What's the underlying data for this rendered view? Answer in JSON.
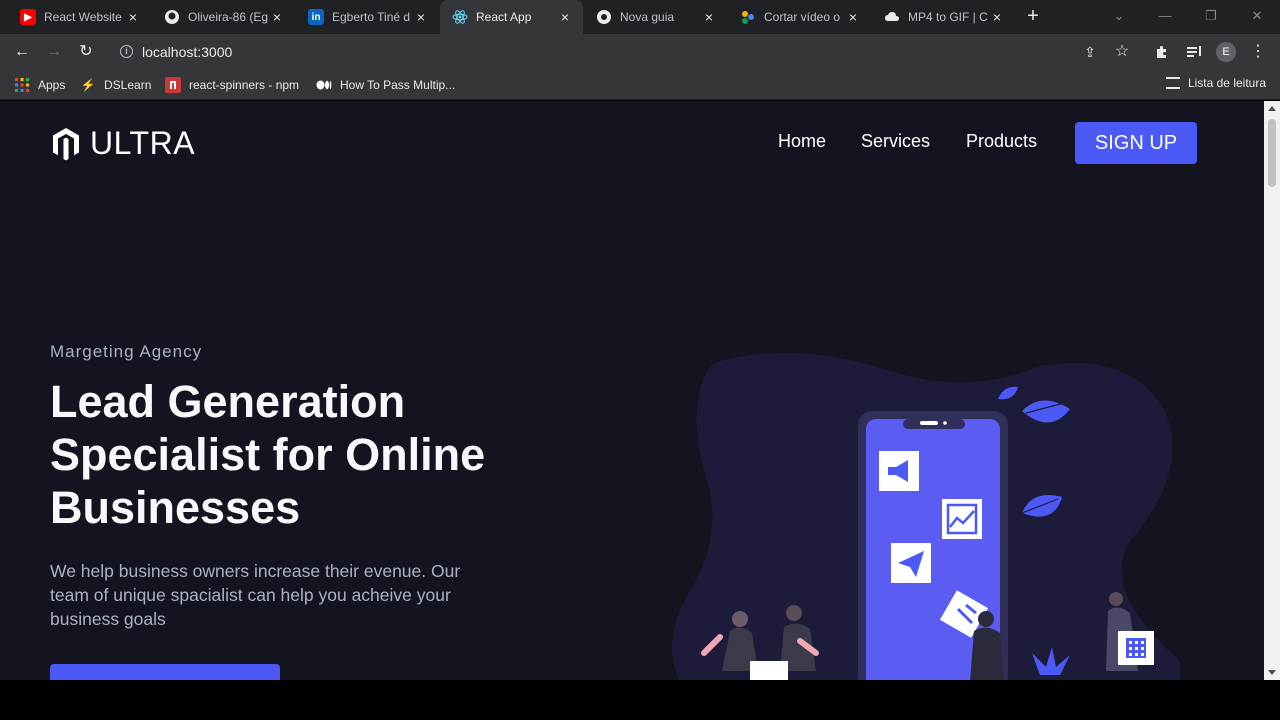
{
  "browser": {
    "tabs": [
      {
        "title": "React Website",
        "favicon": "youtube-icon",
        "active": false
      },
      {
        "title": "Oliveira-86 (Eg",
        "favicon": "github-icon",
        "active": false
      },
      {
        "title": "Egberto Tiné d",
        "favicon": "linkedin-icon",
        "active": false
      },
      {
        "title": "React App",
        "favicon": "react-icon",
        "active": true
      },
      {
        "title": "Nova guia",
        "favicon": "chrome-icon",
        "active": false
      },
      {
        "title": "Cortar vídeo o",
        "favicon": "clipchamp-icon",
        "active": false
      },
      {
        "title": "MP4 to GIF | C",
        "favicon": "cloudconvert-icon",
        "active": false
      }
    ],
    "url": "localhost:3000",
    "profile_initial": "E",
    "bookmarks": [
      {
        "label": "Apps",
        "icon": "apps-grid-icon"
      },
      {
        "label": "DSLearn",
        "icon": "lightning-icon"
      },
      {
        "label": "react-spinners - npm",
        "icon": "npm-icon"
      },
      {
        "label": "How To Pass Multip...",
        "icon": "medium-icon"
      }
    ],
    "reading_list": "Lista de leitura"
  },
  "page": {
    "brand": "ULTRA",
    "nav": [
      "Home",
      "Services",
      "Products"
    ],
    "signup": "SIGN UP",
    "eyebrow": "Margeting Agency",
    "headline": "Lead Generation Specialist for Online Businesses",
    "description": "We help business owners increase their evenue. Our team of unique spacialist can help you acheive your business goals",
    "colors": {
      "background": "#141420",
      "accent": "#4b59f7",
      "text_primary": "#f7f8fa",
      "text_secondary": "#a9b3c1",
      "blob": "#1c1c3a"
    }
  }
}
